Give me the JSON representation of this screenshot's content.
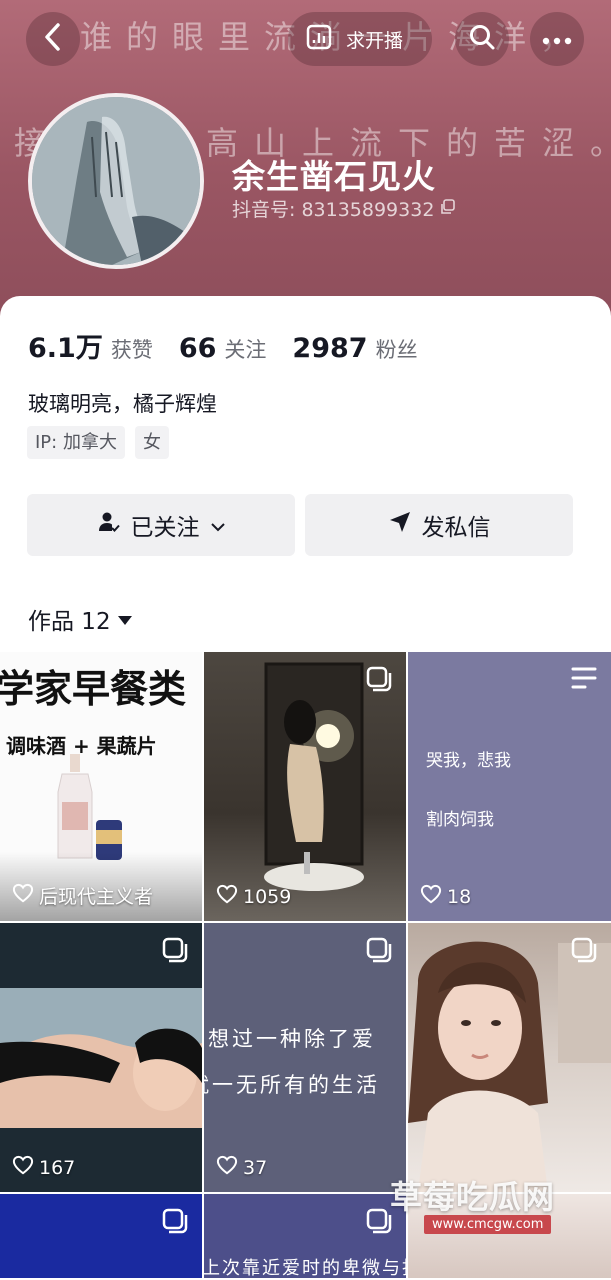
{
  "header": {
    "bg_line_1": "谁的眼里流淌一片海洋，",
    "bg_line_2": "接住一座高山上流下的苦涩。",
    "live_label": "求开播",
    "nickname": "余生凿石见火",
    "douyin_id": "抖音号: 83135899332"
  },
  "stats": [
    {
      "num": "6.1万",
      "label": "获赞"
    },
    {
      "num": "66",
      "label": "关注"
    },
    {
      "num": "2987",
      "label": "粉丝"
    }
  ],
  "signature": "玻璃明亮，橘子辉煌",
  "tags": [
    "IP: 加拿大",
    "女"
  ],
  "buttons": {
    "follow": "已关注",
    "message": "发私信"
  },
  "works": {
    "label": "作品 12"
  },
  "videos": [
    {
      "likes": "后现代主义者",
      "title": "学家早餐类",
      "subtitle": "调味酒 + 果蔬片"
    },
    {
      "likes": "1059"
    },
    {
      "likes": "18",
      "line1": "哭我，悲我",
      "line2": "割肉饲我"
    },
    {
      "likes": "167"
    },
    {
      "likes": "37",
      "line1": "想过一种除了爱",
      "line2": "就一无所有的生活"
    },
    {
      "likes": ""
    },
    {
      "likes": ""
    },
    {
      "likes": "",
      "line1": "上次靠近爱时的卑微与担忧"
    },
    {
      "likes": ""
    }
  ],
  "watermark": {
    "text": "草莓吃瓜网",
    "url": "www.cmcgw.com"
  },
  "colors": {
    "header_bg": "#9a5663",
    "text_primary": "#161823",
    "button_bg": "#f0f0f2"
  }
}
